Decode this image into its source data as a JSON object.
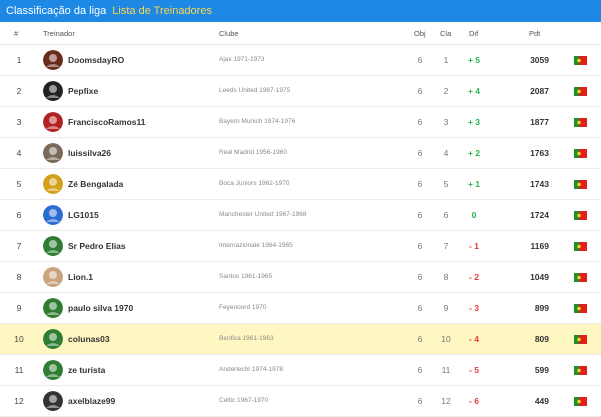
{
  "tabs": {
    "active": "Classificação da liga",
    "other": "Lista de Treinadores"
  },
  "columns": {
    "rank": "#",
    "coach": "Treinador",
    "club": "Clube",
    "obj": "Obj",
    "cla": "Cla",
    "dif": "Dif",
    "pts": "Pdt"
  },
  "rows": [
    {
      "rank": "1",
      "name": "DoomsdayRO",
      "club": "Ajax 1971-1973",
      "obj": "6",
      "cla": "1",
      "dif": "+ 5",
      "pts": "3059",
      "avatar": "#6b2a1e"
    },
    {
      "rank": "2",
      "name": "Pepfixe",
      "club": "Leeds United 1967-1975",
      "obj": "6",
      "cla": "2",
      "dif": "+ 4",
      "pts": "2087",
      "avatar": "#222222"
    },
    {
      "rank": "3",
      "name": "FranciscoRamos11",
      "club": "Bayern Munich 1974-1976",
      "obj": "6",
      "cla": "3",
      "dif": "+ 3",
      "pts": "1877",
      "avatar": "#b22222"
    },
    {
      "rank": "4",
      "name": "luissilva26",
      "club": "Real Madrid 1956-1960",
      "obj": "6",
      "cla": "4",
      "dif": "+ 2",
      "pts": "1763",
      "avatar": "#7a6a5a"
    },
    {
      "rank": "5",
      "name": "Zé Bengalada",
      "club": "Boca Juniors 1962-1970",
      "obj": "6",
      "cla": "5",
      "dif": "+ 1",
      "pts": "1743",
      "avatar": "#d4a017"
    },
    {
      "rank": "6",
      "name": "LG1015",
      "club": "Manchester United 1967-1968",
      "obj": "6",
      "cla": "6",
      "dif": "0",
      "pts": "1724",
      "avatar": "#2b6cd4"
    },
    {
      "rank": "7",
      "name": "Sr Pedro Elias",
      "club": "Internazionale 1964-1965",
      "obj": "6",
      "cla": "7",
      "dif": "- 1",
      "pts": "1169",
      "avatar": "#2e7d32"
    },
    {
      "rank": "8",
      "name": "Lion.1",
      "club": "Santos 1961-1965",
      "obj": "6",
      "cla": "8",
      "dif": "- 2",
      "pts": "1049",
      "avatar": "#c9a27e"
    },
    {
      "rank": "9",
      "name": "paulo silva 1970",
      "club": "Feyenoord 1970",
      "obj": "6",
      "cla": "9",
      "dif": "- 3",
      "pts": "899",
      "avatar": "#2e7d32"
    },
    {
      "rank": "10",
      "name": "colunas03",
      "club": "Benfica 1961-1963",
      "obj": "6",
      "cla": "10",
      "dif": "- 4",
      "pts": "809",
      "avatar": "#2e7d32"
    },
    {
      "rank": "11",
      "name": "ze turista",
      "club": "Anderlecht 1974-1978",
      "obj": "6",
      "cla": "11",
      "dif": "- 5",
      "pts": "599",
      "avatar": "#2e7d32"
    },
    {
      "rank": "12",
      "name": "axelblaze99",
      "club": "Celtic 1967-1970",
      "obj": "6",
      "cla": "12",
      "dif": "- 6",
      "pts": "449",
      "avatar": "#333333"
    }
  ],
  "highlighted_rank": "10",
  "colors": {
    "topbar": "#1e88e5",
    "tab_link": "#ffd54f",
    "positive": "#27b64a",
    "negative": "#e53935",
    "highlight_row": "#fff7c2"
  },
  "icons": {
    "flag": "portugal-flag-icon"
  }
}
